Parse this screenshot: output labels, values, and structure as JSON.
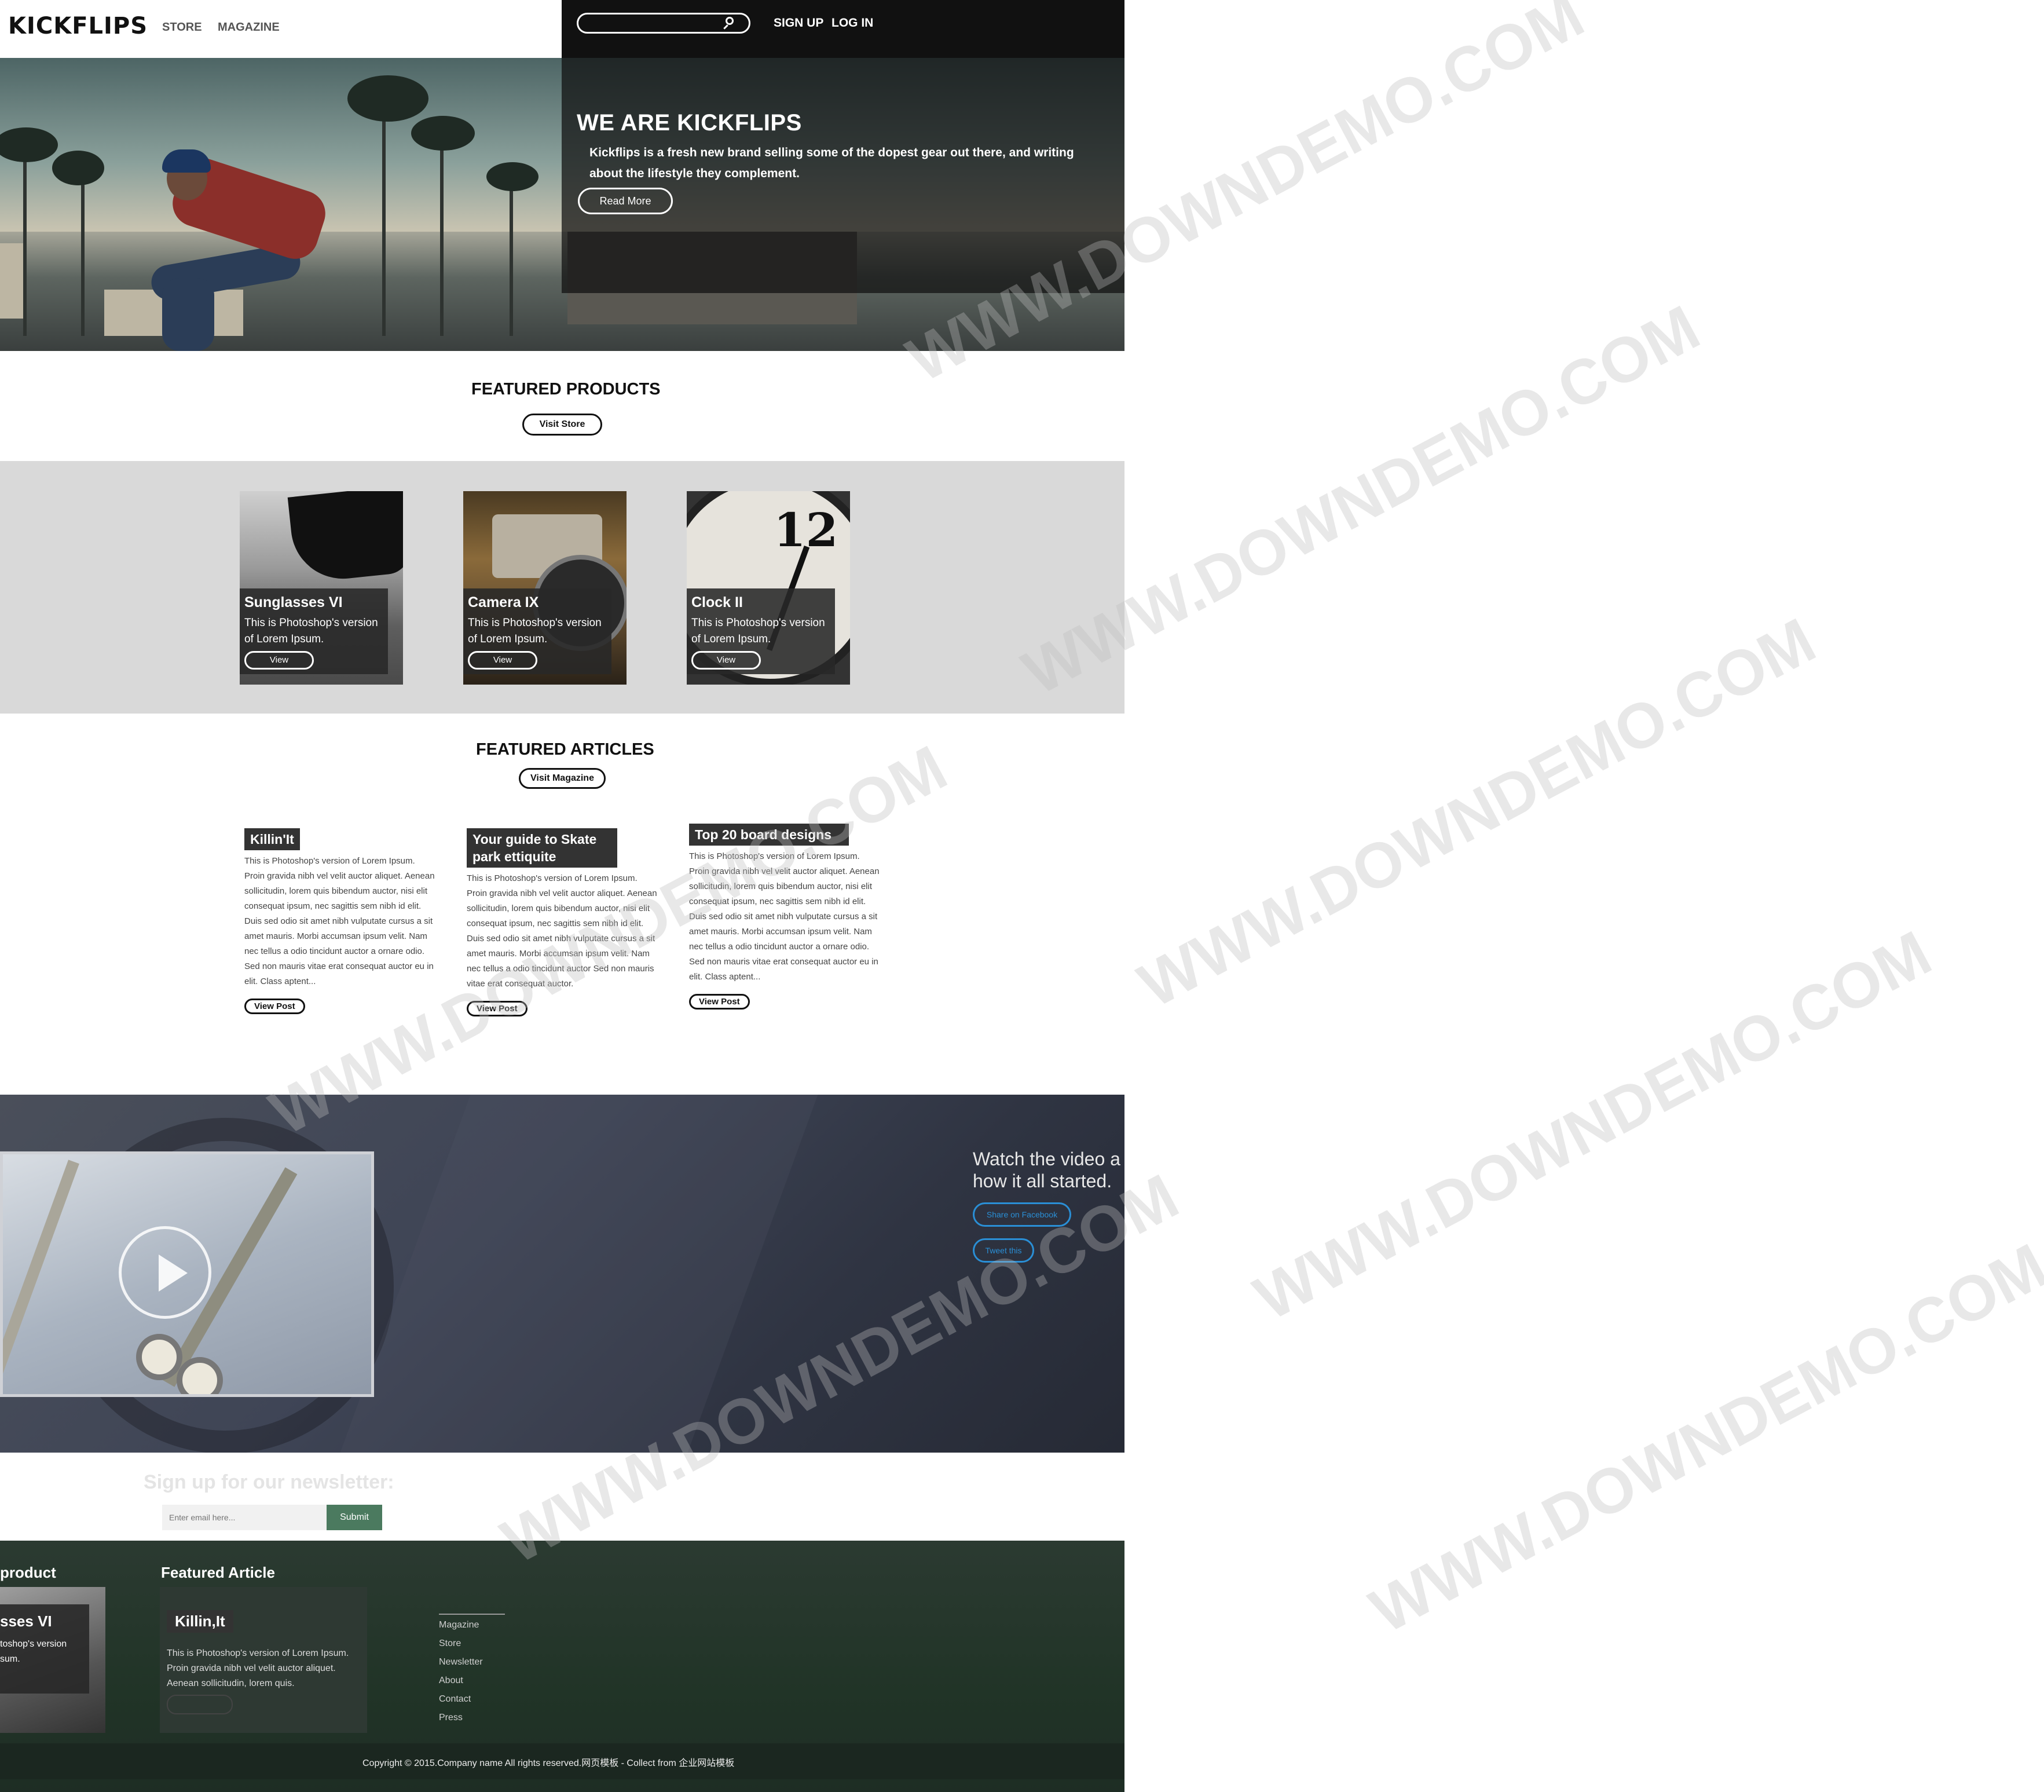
{
  "header": {
    "logo": "KICKFLIPS",
    "nav": [
      "STORE",
      "MAGAZINE"
    ],
    "search_placeholder": "",
    "auth": [
      "SIGN UP",
      "LOG IN"
    ]
  },
  "hero": {
    "title": "WE ARE KICKFLIPS",
    "text": "Kickflips is a fresh new brand selling some of the dopest gear out there, and writing about the lifestyle they complement.",
    "button": "Read More"
  },
  "featured_products": {
    "title": "FEATURED PRODUCTS",
    "button": "Visit Store",
    "items": [
      {
        "name": "Sunglasses VI",
        "desc": "This is Photoshop's version of Lorem Ipsum.",
        "button": "View"
      },
      {
        "name": "Camera IX",
        "desc": "This is Photoshop's version of Lorem Ipsum.",
        "button": "View"
      },
      {
        "name": "Clock II",
        "desc": "This is Photoshop's version of Lorem Ipsum.",
        "button": "View"
      }
    ]
  },
  "featured_articles": {
    "title": "FEATURED ARTICLES",
    "button": "Visit Magazine",
    "items": [
      {
        "title": "Killin'It",
        "text": "This is Photoshop's version of Lorem Ipsum. Proin gravida nibh vel velit auctor aliquet. Aenean sollicitudin, lorem quis bibendum auctor, nisi elit consequat ipsum, nec sagittis sem nibh id elit. Duis sed odio sit amet nibh vulputate cursus a sit amet mauris. Morbi accumsan ipsum velit. Nam nec tellus a odio tincidunt auctor a ornare odio. Sed non mauris vitae erat consequat auctor eu in elit. Class aptent...",
        "button": "View Post"
      },
      {
        "title": "Your guide to Skate park ettiquite",
        "text": "This is Photoshop's version of Lorem Ipsum. Proin gravida nibh vel velit auctor aliquet. Aenean sollicitudin, lorem quis bibendum auctor, nisi elit consequat ipsum, nec sagittis sem nibh id elit. Duis sed odio sit amet nibh vulputate cursus a sit amet mauris. Morbi accumsan ipsum velit. Nam nec tellus a odio tincidunt auctor Sed non mauris vitae erat consequat auctor.",
        "button": "View Post"
      },
      {
        "title": "Top 20 board designs",
        "text": "This is Photoshop's version of Lorem Ipsum. Proin gravida nibh vel velit auctor aliquet. Aenean sollicitudin, lorem quis bibendum auctor, nisi elit consequat ipsum, nec sagittis sem nibh id elit. Duis sed odio sit amet nibh vulputate cursus a sit amet mauris. Morbi accumsan ipsum velit. Nam nec tellus a odio tincidunt auctor a ornare odio. Sed non mauris vitae erat consequat auctor eu in elit. Class aptent...",
        "button": "View Post"
      }
    ]
  },
  "video": {
    "heading_line1": "Watch the video a",
    "heading_line2": "how it all started.",
    "share_facebook": "Share on Facebook",
    "tweet": "Tweet this"
  },
  "newsletter": {
    "title": "Sign up for our newsletter:",
    "placeholder": "Enter email here...",
    "button": "Submit"
  },
  "footer": {
    "product_heading": "product",
    "product_name": "sses VI",
    "product_desc": "toshop's version sum.",
    "article_heading": "Featured Article",
    "article_title": "Killin,It",
    "article_text": "This is Photoshop's version of Lorem Ipsum. Proin gravida nibh vel velit auctor aliquet. Aenean sollicitudin, lorem quis.",
    "links": [
      "Magazine",
      "Store",
      "Newsletter",
      "About",
      "Contact",
      "Press"
    ],
    "copyright": "Copyright © 2015.Company name All rights reserved.网页模板 - Collect from 企业网站模板"
  },
  "watermark": "WWW.DOWNDEMO.COM"
}
